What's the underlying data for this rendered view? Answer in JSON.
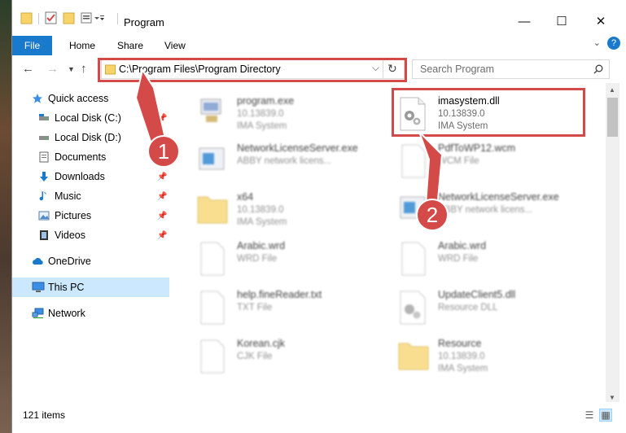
{
  "window": {
    "title": "Program",
    "minimize": "—",
    "maximize": "☐",
    "close": "✕"
  },
  "ribbon": {
    "file": "File",
    "tabs": [
      "Home",
      "Share",
      "View"
    ],
    "help": "?"
  },
  "address": {
    "path": "C:\\Program Files\\Program Directory",
    "refresh": "↻",
    "dropdown": "⌵"
  },
  "search": {
    "placeholder": "Search Program"
  },
  "sidebar": {
    "items": [
      {
        "label": "Quick access",
        "icon": "star-icon"
      },
      {
        "label": "Local Disk (C:)",
        "icon": "drive-icon"
      },
      {
        "label": "Local Disk (D:)",
        "icon": "drive-icon"
      },
      {
        "label": "Documents",
        "icon": "documents-icon"
      },
      {
        "label": "Downloads",
        "icon": "download-icon"
      },
      {
        "label": "Music",
        "icon": "music-icon"
      },
      {
        "label": "Pictures",
        "icon": "pictures-icon"
      },
      {
        "label": "Videos",
        "icon": "videos-icon"
      },
      {
        "label": "OneDrive",
        "icon": "cloud-icon"
      },
      {
        "label": "This PC",
        "icon": "computer-icon"
      },
      {
        "label": "Network",
        "icon": "network-icon"
      }
    ],
    "pin": "📌"
  },
  "files": [
    {
      "name": "program.exe",
      "line1": "10.13839.0",
      "line2": "IMA System"
    },
    {
      "name": "imasystem.dll",
      "line1": "10.13839.0",
      "line2": "IMA System"
    },
    {
      "name": "NetworkLicenseServer.exe",
      "line1": "ABBY network licens...",
      "line2": ""
    },
    {
      "name": "PdfToWP12.wcm",
      "line1": "WCM File",
      "line2": ""
    },
    {
      "name": "x64",
      "line1": "10.13839.0",
      "line2": "IMA System"
    },
    {
      "name": "NetworkLicenseServer.exe",
      "line1": "ABBY network licens...",
      "line2": ""
    },
    {
      "name": "Arabic.wrd",
      "line1": "WRD File",
      "line2": ""
    },
    {
      "name": "Arabic.wrd",
      "line1": "WRD File",
      "line2": ""
    },
    {
      "name": "help.fineReader.txt",
      "line1": "TXT File",
      "line2": ""
    },
    {
      "name": "UpdateClient5.dll",
      "line1": "Resource DLL",
      "line2": ""
    },
    {
      "name": "Korean.cjk",
      "line1": "CJK File",
      "line2": ""
    },
    {
      "name": "Resource",
      "line1": "10.13839.0",
      "line2": "IMA System"
    }
  ],
  "status": {
    "count": "121 items"
  },
  "markers": [
    "1",
    "2"
  ],
  "colors": {
    "accent": "#1979ca",
    "callout": "#d44a48",
    "selection": "#cce8ff"
  }
}
